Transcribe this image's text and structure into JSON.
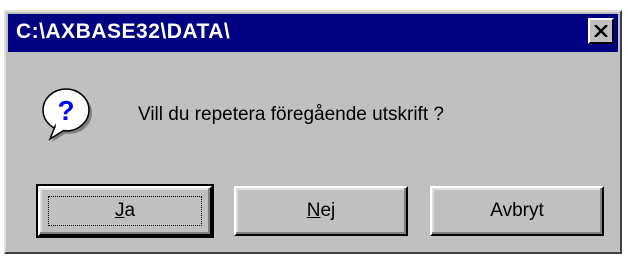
{
  "dialog": {
    "title": "C:\\AXBASE32\\DATA\\",
    "message": "Vill du repetera föregående utskrift ?",
    "icon": "question-icon"
  },
  "buttons": {
    "yes": {
      "accel": "J",
      "rest": "a"
    },
    "no": {
      "accel": "N",
      "rest": "ej"
    },
    "cancel": {
      "label": "Avbryt"
    }
  },
  "colors": {
    "titlebar": "#000080",
    "face": "#c0c0c0",
    "icon_bubble": "#ffffff",
    "icon_glyph": "#0000ff"
  }
}
